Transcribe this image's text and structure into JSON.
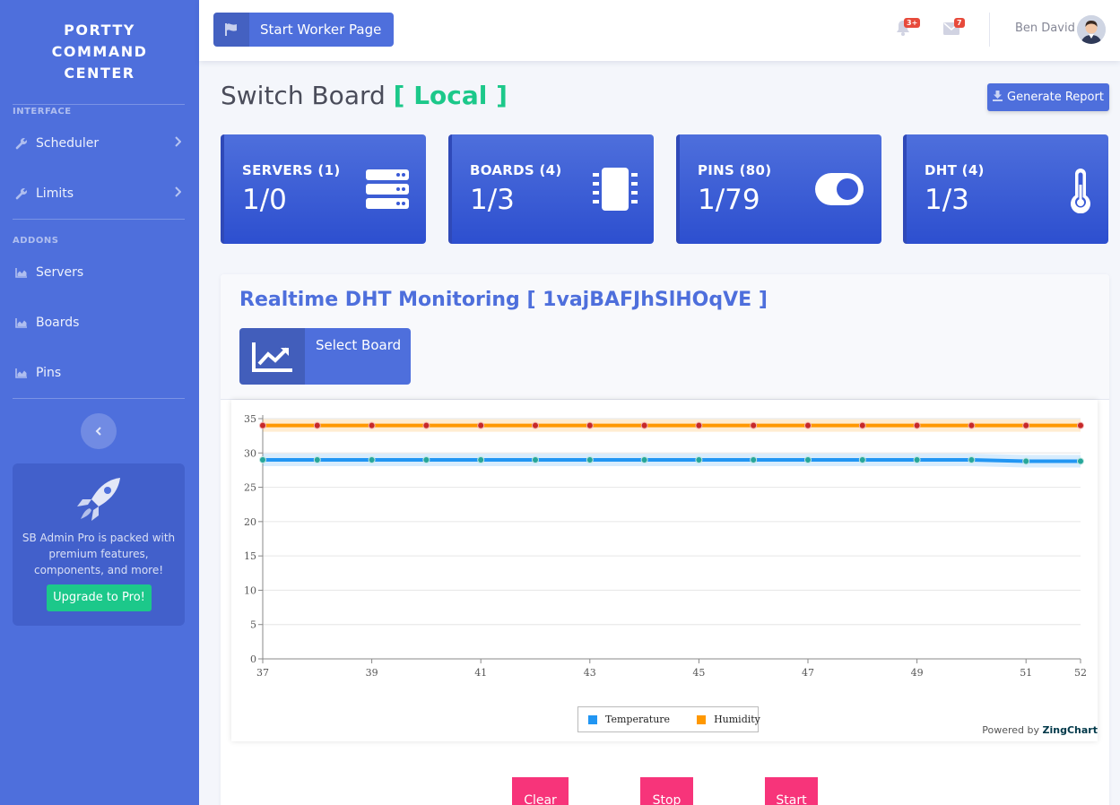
{
  "sidebar": {
    "brand_line1": "PORTTY",
    "brand_line2": "COMMAND",
    "brand_line3": "CENTER",
    "section_interface": "INTERFACE",
    "section_addons": "ADDONS",
    "items": [
      {
        "label": "Scheduler",
        "icon": "wrench-icon"
      },
      {
        "label": "Limits",
        "icon": "wrench-icon"
      },
      {
        "label": "Servers",
        "icon": "chart-area-icon"
      },
      {
        "label": "Boards",
        "icon": "chart-area-icon"
      },
      {
        "label": "Pins",
        "icon": "chart-area-icon"
      }
    ],
    "promo_text": "SB Admin Pro is packed with premium features, components, and more!",
    "upgrade_label": "Upgrade to Pro!"
  },
  "topbar": {
    "worker_button": "Start Worker Page",
    "alerts_badge": "3+",
    "messages_badge": "7",
    "user_name": "Ben David"
  },
  "page": {
    "title": "Switch Board",
    "title_accent": "[ Local ]",
    "report_button": "Generate Report"
  },
  "cards": [
    {
      "title": "SERVERS (1)",
      "value": "1/0",
      "icon": "server-icon"
    },
    {
      "title": "BOARDS (4)",
      "value": "1/3",
      "icon": "microchip-icon"
    },
    {
      "title": "PINS (80)",
      "value": "1/79",
      "icon": "toggle-on-icon"
    },
    {
      "title": "DHT (4)",
      "value": "1/3",
      "icon": "thermometer-icon"
    }
  ],
  "monitor": {
    "title": "Realtime DHT Monitoring [ 1vajBAFJhSlHOqVE ]",
    "select_board": "Select Board",
    "powered_prefix": "Powered by",
    "powered_brand": "ZingChart",
    "buttons": {
      "clear": "Clear",
      "stop": "Stop",
      "start": "Start"
    }
  },
  "chart_data": {
    "type": "line",
    "x": [
      37,
      38,
      39,
      40,
      41,
      42,
      43,
      44,
      45,
      46,
      47,
      48,
      49,
      50,
      51,
      52
    ],
    "x_tick_labels": [
      "37",
      "39",
      "41",
      "43",
      "45",
      "47",
      "49",
      "51",
      "52"
    ],
    "y_tick_labels": [
      "0",
      "5",
      "10",
      "15",
      "20",
      "25",
      "30",
      "35"
    ],
    "ylim": [
      0,
      35
    ],
    "xlim": [
      37,
      52
    ],
    "grid": true,
    "legend_position": "bottom-center",
    "series": [
      {
        "name": "Temperature",
        "color": "#2196f3",
        "marker_color": "#26a69a",
        "values": [
          29,
          29,
          29,
          29,
          29,
          29,
          29,
          29,
          29,
          29,
          29,
          29,
          29,
          29,
          28.8,
          28.8
        ]
      },
      {
        "name": "Humidity",
        "color": "#ff9800",
        "marker_color": "#c62828",
        "values": [
          34,
          34,
          34,
          34,
          34,
          34,
          34,
          34,
          34,
          34,
          34,
          34,
          34,
          34,
          34,
          34
        ]
      }
    ]
  }
}
